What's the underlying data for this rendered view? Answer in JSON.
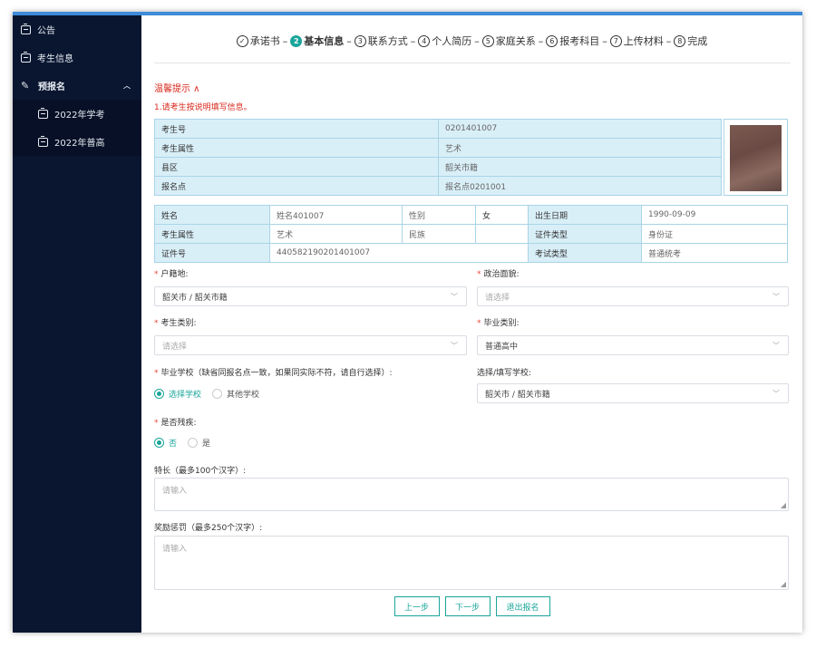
{
  "sidebar": {
    "items": [
      {
        "label": "公告"
      },
      {
        "label": "考生信息"
      },
      {
        "label": "预报名"
      },
      {
        "label": "2022年学考"
      },
      {
        "label": "2022年普高"
      }
    ]
  },
  "steps": [
    {
      "num": "✓",
      "label": "承诺书"
    },
    {
      "num": "2",
      "label": "基本信息"
    },
    {
      "num": "3",
      "label": "联系方式"
    },
    {
      "num": "4",
      "label": "个人简历"
    },
    {
      "num": "5",
      "label": "家庭关系"
    },
    {
      "num": "6",
      "label": "报考科目"
    },
    {
      "num": "7",
      "label": "上传材料"
    },
    {
      "num": "8",
      "label": "完成"
    }
  ],
  "step_separator": "–",
  "tip": {
    "title": "温馨提示 ∧",
    "body": "1.请考生按说明填写信息。"
  },
  "info_table": {
    "rows": [
      {
        "label": "考生号",
        "value": "0201401007"
      },
      {
        "label": "考生属性",
        "value": "艺术"
      },
      {
        "label": "县区",
        "value": "韶关市籍"
      },
      {
        "label": "报名点",
        "value": "报名点0201001"
      }
    ]
  },
  "detail_table": {
    "rows": [
      [
        "姓名",
        "姓名401007",
        "性别",
        "女",
        "出生日期",
        "1990-09-09"
      ],
      [
        "考生属性",
        "艺术",
        "民族",
        "",
        "证件类型",
        "身份证"
      ],
      [
        "证件号",
        "440582190201401007",
        "",
        "",
        "考试类型",
        "普通统考"
      ]
    ]
  },
  "form": {
    "huji_label": "户籍地:",
    "huji_value": "韶关市 / 韶关市籍",
    "zhengzhi_label": "政治面貌:",
    "zhengzhi_placeholder": "请选择",
    "kaoshengleibie_label": "考生类别:",
    "kaoshengleibie_placeholder": "请选择",
    "biyeleibie_label": "毕业类别:",
    "biyeleibie_value": "普通高中",
    "school_label": "毕业学校（缺省同报名点一致，如果同实际不符，请自行选择）:",
    "school_radio_1": "选择学校",
    "school_radio_2": "其他学校",
    "school_select_label": "选择/填写学校:",
    "school_select_value": "韶关市 / 韶关市籍",
    "disabled_label": "是否残疾:",
    "disabled_no": "否",
    "disabled_yes": "是",
    "talent_label": "特长（最多100个汉字）:",
    "talent_placeholder": "请输入",
    "reward_label": "奖励惩罚（最多250个汉字）:",
    "reward_placeholder": "请输入"
  },
  "buttons": {
    "prev": "上一步",
    "next": "下一步",
    "exit": "退出报名"
  },
  "colors": {
    "accent": "#1aa59a",
    "sidebar_bg": "#0a1630",
    "top_bar": "#3d8bd9",
    "warning": "#d9281c"
  }
}
